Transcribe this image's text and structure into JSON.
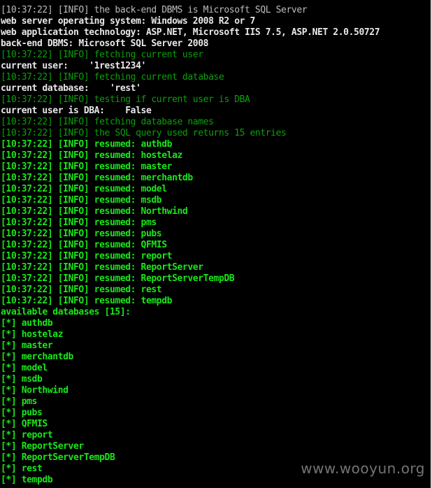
{
  "terminal": {
    "lines": [
      {
        "text": "[10:37:22] [INFO] the back-end DBMS is Microsoft SQL Server",
        "style": "dim-white"
      },
      {
        "text": "web server operating system: Windows 2008 R2 or 7",
        "style": "white"
      },
      {
        "text": "web application technology: ASP.NET, Microsoft IIS 7.5, ASP.NET 2.0.50727",
        "style": "white"
      },
      {
        "text": "back-end DBMS: Microsoft SQL Server 2008",
        "style": "white"
      },
      {
        "text": "[10:37:22] [INFO] fetching current user",
        "style": "dim-green"
      },
      {
        "text": "current user:    '1rest1234'",
        "style": "white"
      },
      {
        "text": "[10:37:22] [INFO] fetching current database",
        "style": "dim-green"
      },
      {
        "text": "current database:    'rest'",
        "style": "white"
      },
      {
        "text": "[10:37:22] [INFO] testing if current user is DBA",
        "style": "dim-green"
      },
      {
        "text": "current user is DBA:    False",
        "style": "white"
      },
      {
        "text": "[10:37:22] [INFO] fetching database names",
        "style": "dim-green"
      },
      {
        "text": "[10:37:22] [INFO] the SQL query used returns 15 entries",
        "style": "dim-green"
      },
      {
        "text": "[10:37:22] [INFO] resumed: authdb",
        "style": "green"
      },
      {
        "text": "[10:37:22] [INFO] resumed: hostelaz",
        "style": "green"
      },
      {
        "text": "[10:37:22] [INFO] resumed: master",
        "style": "green"
      },
      {
        "text": "[10:37:22] [INFO] resumed: merchantdb",
        "style": "green"
      },
      {
        "text": "[10:37:22] [INFO] resumed: model",
        "style": "green"
      },
      {
        "text": "[10:37:22] [INFO] resumed: msdb",
        "style": "green"
      },
      {
        "text": "[10:37:22] [INFO] resumed: Northwind",
        "style": "green"
      },
      {
        "text": "[10:37:22] [INFO] resumed: pms",
        "style": "green"
      },
      {
        "text": "[10:37:22] [INFO] resumed: pubs",
        "style": "green"
      },
      {
        "text": "[10:37:22] [INFO] resumed: QFMIS",
        "style": "green"
      },
      {
        "text": "[10:37:22] [INFO] resumed: report",
        "style": "green"
      },
      {
        "text": "[10:37:22] [INFO] resumed: ReportServer",
        "style": "green"
      },
      {
        "text": "[10:37:22] [INFO] resumed: ReportServerTempDB",
        "style": "green"
      },
      {
        "text": "[10:37:22] [INFO] resumed: rest",
        "style": "green"
      },
      {
        "text": "[10:37:22] [INFO] resumed: tempdb",
        "style": "green"
      },
      {
        "text": "available databases [15]:",
        "style": "green"
      },
      {
        "text": "[*] authdb",
        "style": "green"
      },
      {
        "text": "[*] hostelaz",
        "style": "green"
      },
      {
        "text": "[*] master",
        "style": "green"
      },
      {
        "text": "[*] merchantdb",
        "style": "green"
      },
      {
        "text": "[*] model",
        "style": "green"
      },
      {
        "text": "[*] msdb",
        "style": "green"
      },
      {
        "text": "[*] Northwind",
        "style": "green"
      },
      {
        "text": "[*] pms",
        "style": "green"
      },
      {
        "text": "[*] pubs",
        "style": "green"
      },
      {
        "text": "[*] QFMIS",
        "style": "green"
      },
      {
        "text": "[*] report",
        "style": "green"
      },
      {
        "text": "[*] ReportServer",
        "style": "green"
      },
      {
        "text": "[*] ReportServerTempDB",
        "style": "green"
      },
      {
        "text": "[*] rest",
        "style": "green"
      },
      {
        "text": "[*] tempdb",
        "style": "green"
      }
    ]
  },
  "watermark": {
    "text": "www.wooyun.org"
  },
  "colors": {
    "background": "#000000",
    "text_white": "#e8e8e8",
    "text_dim_white": "#bdbdbd",
    "text_green": "#18e818",
    "text_dim_green": "#0aa00a"
  }
}
